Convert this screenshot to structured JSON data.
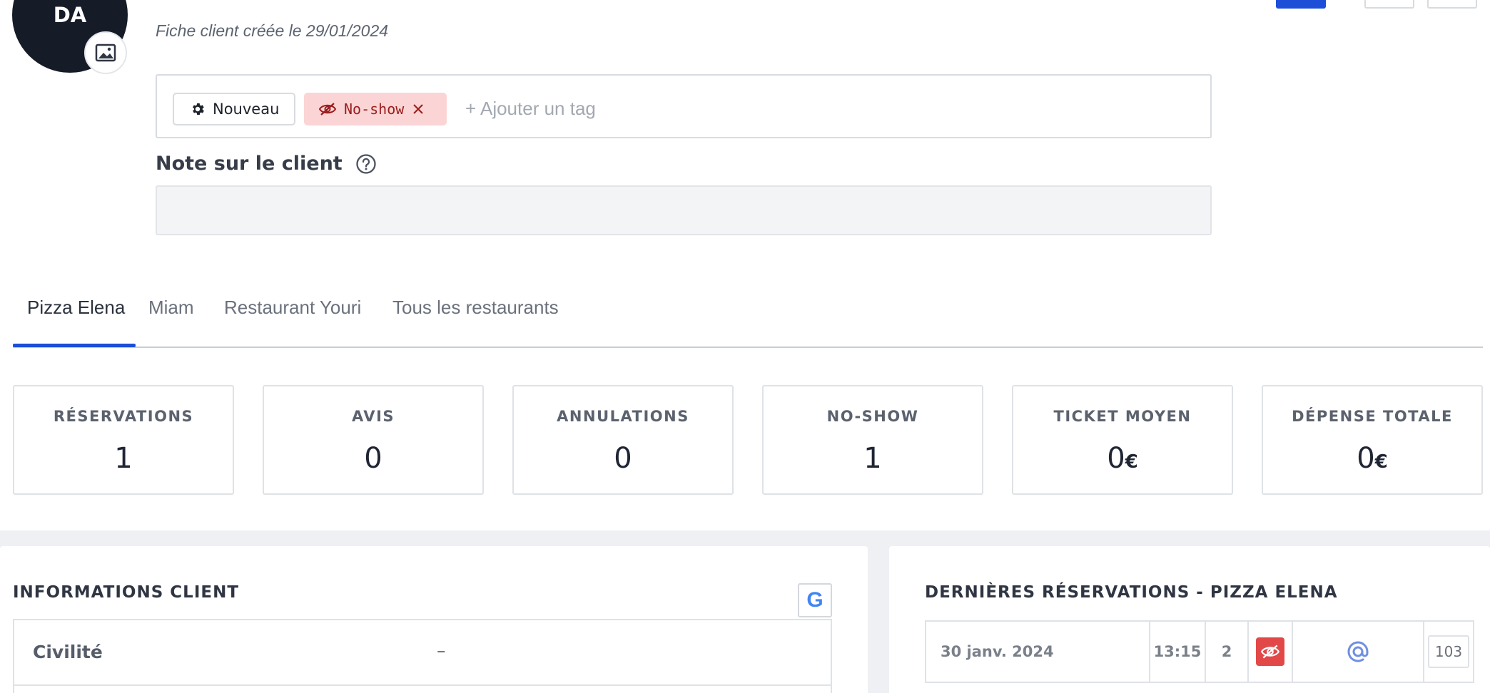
{
  "client": {
    "initials": "DA",
    "created_note": "Fiche client créée le 29/01/2024"
  },
  "tags": {
    "items": [
      {
        "label": "Nouveau",
        "icon": "gear-icon"
      },
      {
        "label": "No-show",
        "icon": "eye-slash-icon",
        "color": "#9b1c1c",
        "background": "#fbd5d5"
      }
    ],
    "add_placeholder": "+ Ajouter un tag"
  },
  "note": {
    "title": "Note sur le client",
    "value": ""
  },
  "tabs": [
    {
      "label": "Pizza Elena",
      "active": true
    },
    {
      "label": "Miam",
      "active": false
    },
    {
      "label": "Restaurant Youri",
      "active": false
    },
    {
      "label": "Tous les restaurants",
      "active": false
    }
  ],
  "stats": [
    {
      "label": "RÉSERVATIONS",
      "value": "1",
      "unit": ""
    },
    {
      "label": "AVIS",
      "value": "0",
      "unit": ""
    },
    {
      "label": "ANNULATIONS",
      "value": "0",
      "unit": ""
    },
    {
      "label": "NO-SHOW",
      "value": "1",
      "unit": ""
    },
    {
      "label": "TICKET MOYEN",
      "value": "0",
      "unit": "€"
    },
    {
      "label": "DÉPENSE TOTALE",
      "value": "0",
      "unit": "€"
    }
  ],
  "info_panel": {
    "title": "INFORMATIONS CLIENT",
    "google_label": "G",
    "rows": [
      {
        "label": "Civilité",
        "value": "–"
      }
    ]
  },
  "reservations_panel": {
    "title": "DERNIÈRES RÉSERVATIONS - PIZZA ELENA",
    "rows": [
      {
        "date": "30 janv. 2024",
        "time": "13:15",
        "covers": "2",
        "status_icon": "eye-slash-icon",
        "source_icon": "at-icon",
        "table": "103"
      }
    ]
  },
  "colors": {
    "primary": "#1d4ed8",
    "noshow_bg": "#fbd5d5",
    "noshow_text": "#9b1c1c",
    "status_red": "#e24848",
    "avatar_bg": "#151b27"
  }
}
